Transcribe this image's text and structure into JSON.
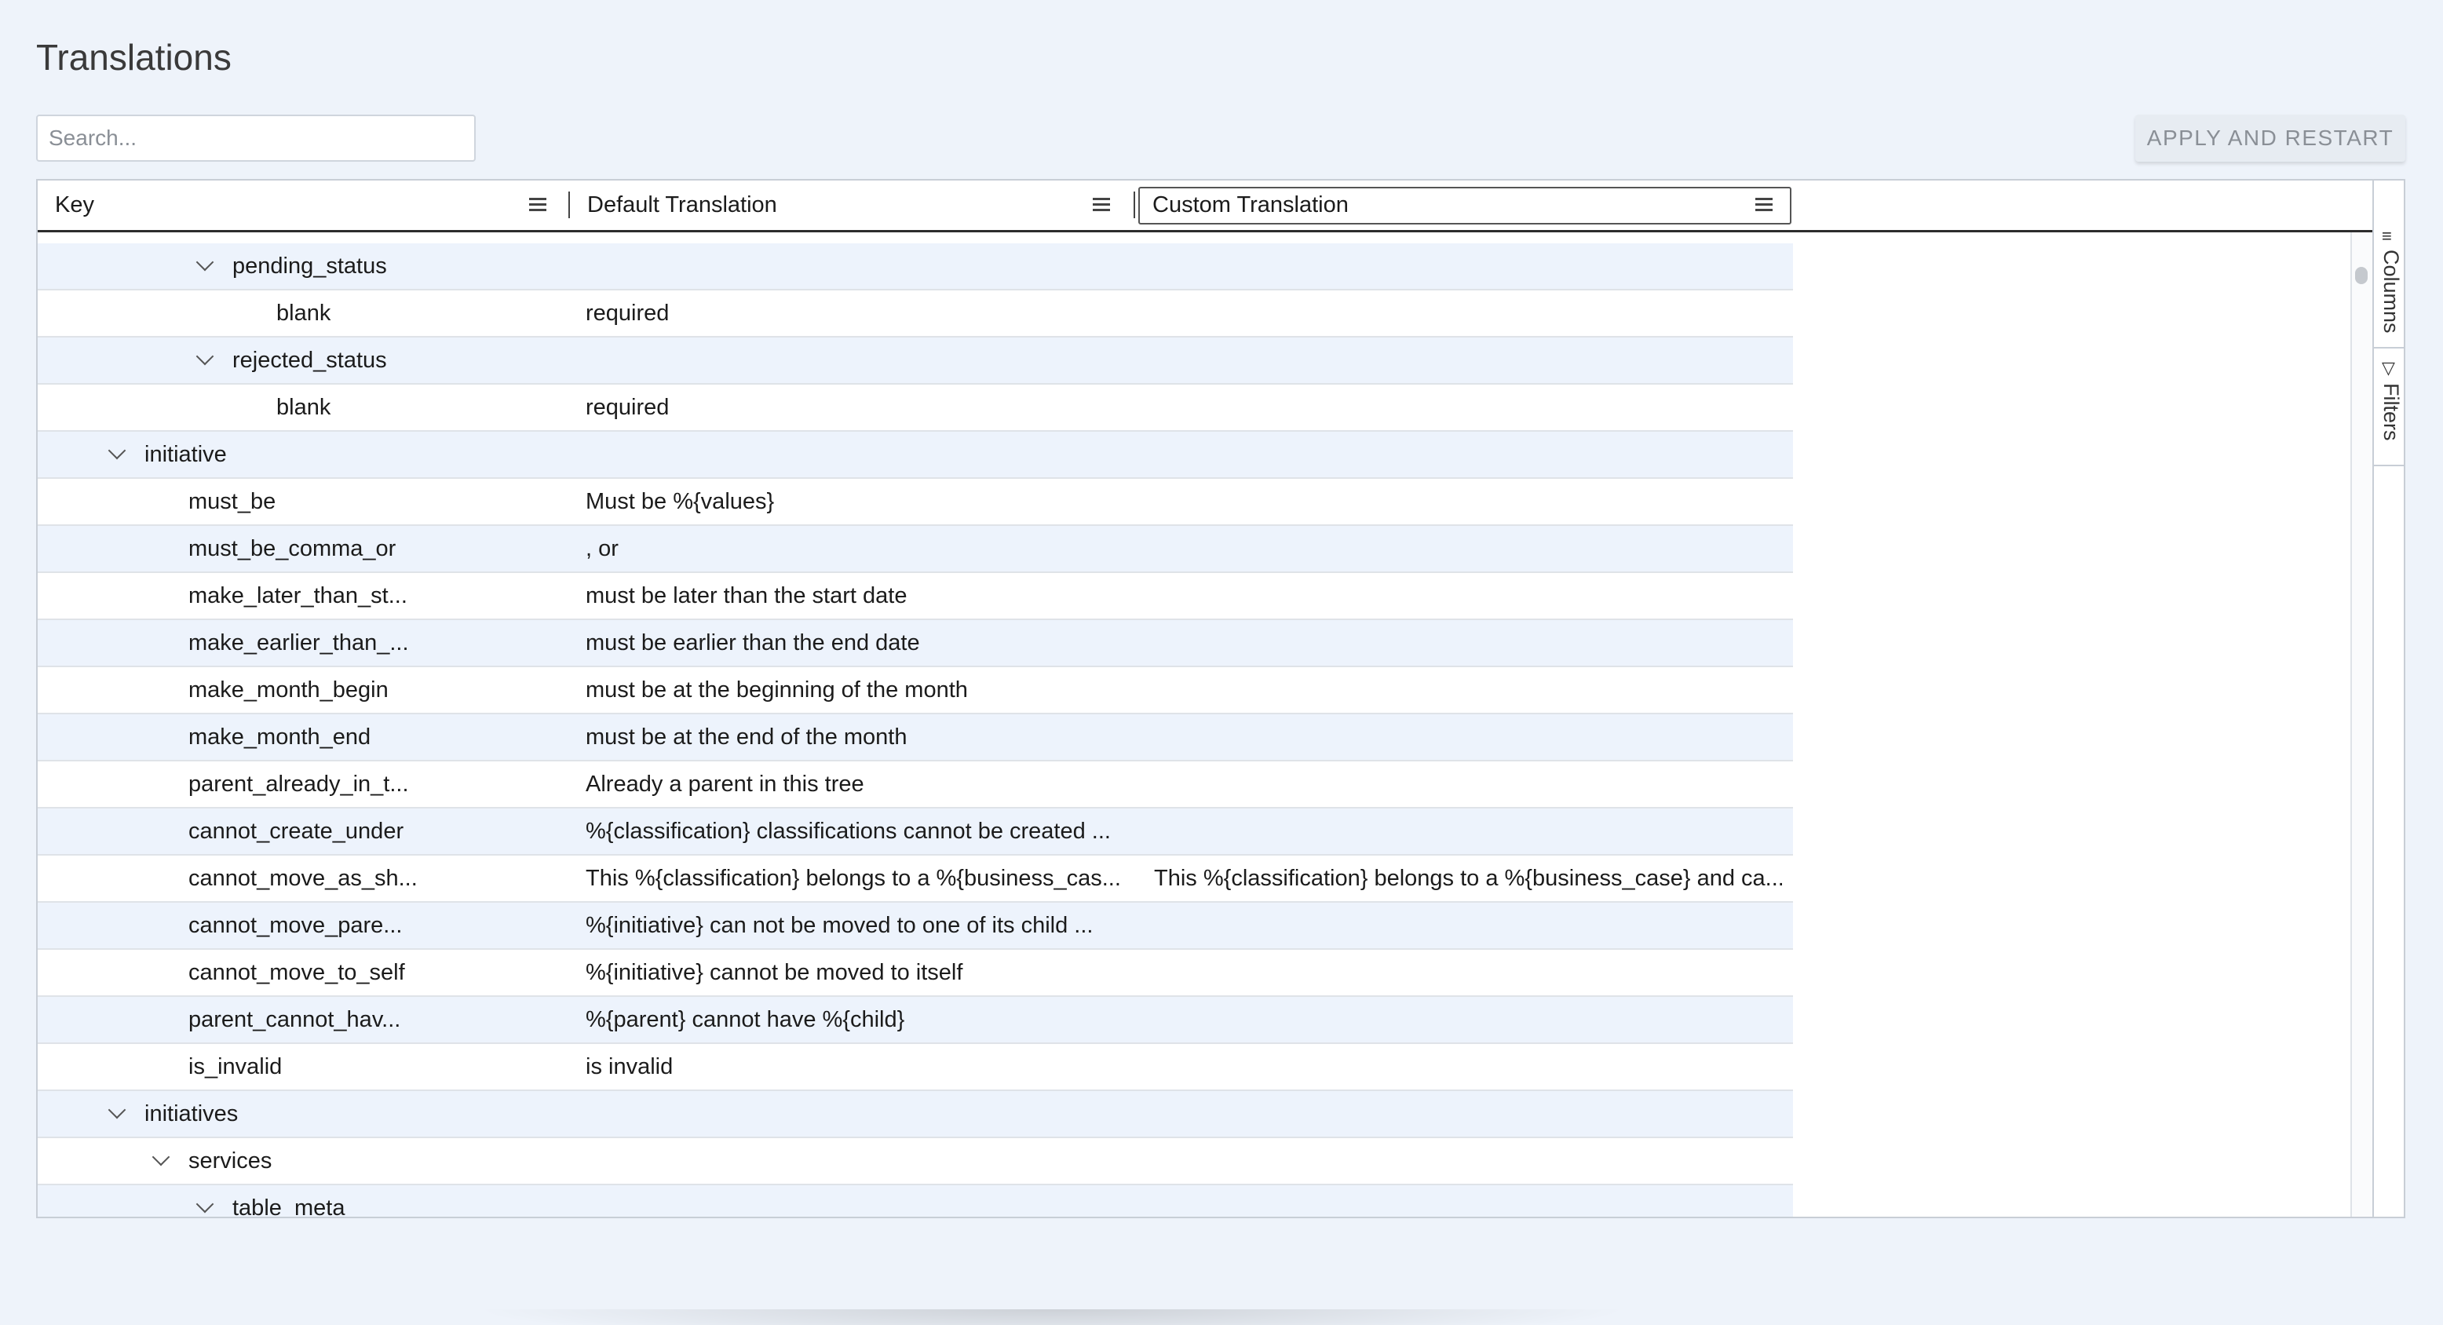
{
  "page": {
    "title": "Translations"
  },
  "search": {
    "placeholder": "Search..."
  },
  "toolbar": {
    "apply_label": "APPLY AND RESTART"
  },
  "grid": {
    "columns": [
      {
        "label": "Key"
      },
      {
        "label": "Default Translation"
      },
      {
        "label": "Custom Translation"
      }
    ],
    "rows": [
      {
        "level": 3,
        "group": true,
        "key": "pending_status",
        "default": "",
        "custom": ""
      },
      {
        "level": 4,
        "group": false,
        "key": "blank",
        "default": "required",
        "custom": ""
      },
      {
        "level": 3,
        "group": true,
        "key": "rejected_status",
        "default": "",
        "custom": ""
      },
      {
        "level": 4,
        "group": false,
        "key": "blank",
        "default": "required",
        "custom": ""
      },
      {
        "level": 1,
        "group": true,
        "key": "initiative",
        "default": "",
        "custom": ""
      },
      {
        "level": 2,
        "group": false,
        "key": "must_be",
        "default": "Must be %{values}",
        "custom": ""
      },
      {
        "level": 2,
        "group": false,
        "key": "must_be_comma_or",
        "default": ", or",
        "custom": ""
      },
      {
        "level": 2,
        "group": false,
        "key": "make_later_than_st...",
        "default": "must be later than the start date",
        "custom": ""
      },
      {
        "level": 2,
        "group": false,
        "key": "make_earlier_than_...",
        "default": "must be earlier than the end date",
        "custom": ""
      },
      {
        "level": 2,
        "group": false,
        "key": "make_month_begin",
        "default": "must be at the beginning of the month",
        "custom": ""
      },
      {
        "level": 2,
        "group": false,
        "key": "make_month_end",
        "default": "must be at the end of the month",
        "custom": ""
      },
      {
        "level": 2,
        "group": false,
        "key": "parent_already_in_t...",
        "default": "Already a parent in this tree",
        "custom": ""
      },
      {
        "level": 2,
        "group": false,
        "key": "cannot_create_under",
        "default": "%{classification} classifications cannot be created ...",
        "custom": ""
      },
      {
        "level": 2,
        "group": false,
        "key": "cannot_move_as_sh...",
        "default": "This %{classification} belongs to a %{business_cas...",
        "custom": "This %{classification} belongs to a %{business_case} and ca..."
      },
      {
        "level": 2,
        "group": false,
        "key": "cannot_move_pare...",
        "default": "%{initiative} can not be moved to one of its child ...",
        "custom": ""
      },
      {
        "level": 2,
        "group": false,
        "key": "cannot_move_to_self",
        "default": "%{initiative} cannot be moved to itself",
        "custom": ""
      },
      {
        "level": 2,
        "group": false,
        "key": "parent_cannot_hav...",
        "default": "%{parent} cannot have %{child}",
        "custom": ""
      },
      {
        "level": 2,
        "group": false,
        "key": "is_invalid",
        "default": "is invalid",
        "custom": ""
      },
      {
        "level": 1,
        "group": true,
        "key": "initiatives",
        "default": "",
        "custom": ""
      },
      {
        "level": 2,
        "group": true,
        "key": "services",
        "default": "",
        "custom": ""
      },
      {
        "level": 3,
        "group": true,
        "key": "table_meta",
        "default": "",
        "custom": ""
      }
    ]
  },
  "side_panel": {
    "columns_label": "Columns",
    "filters_label": "Filters",
    "columns_icon": "columns-icon",
    "filters_icon": "filter-icon"
  }
}
